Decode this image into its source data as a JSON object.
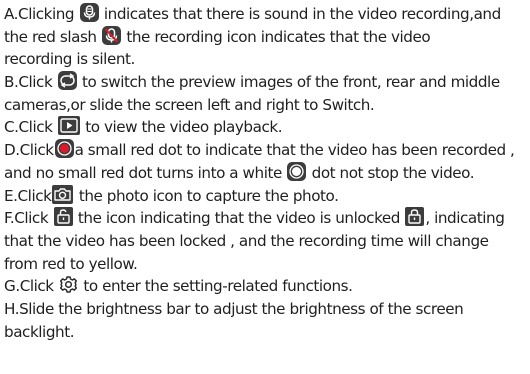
{
  "items": {
    "a": {
      "l1_pre": "A.Clicking ",
      "l1_post": " indicates that there is sound in the video recording,and",
      "l2_pre": "the red slash ",
      "l2_post": " the recording icon indicates that the video",
      "l3": "recording is silent.",
      "icon_sound": "microphone-icon",
      "icon_mute": "microphone-muted-icon"
    },
    "b": {
      "l1_pre": "B.Click ",
      "l1_post": " to switch the preview images of the front, rear and middle",
      "l2": "cameras,or slide the screen left and right to Switch.",
      "icon": "switch-camera-icon"
    },
    "c": {
      "l1_pre": "C.Click ",
      "l1_post": " to view the video playback.",
      "icon": "playback-icon"
    },
    "d": {
      "l1_pre": "D.Click",
      "l1_post": "a small red dot to indicate that the video has been recorded ,",
      "l2_pre": "and no small red dot turns into a white ",
      "l2_post": " dot not stop the video.",
      "icon_recording": "record-red-dot-icon",
      "icon_stopped": "record-white-dot-icon"
    },
    "e": {
      "l1_pre": "E.Click",
      "l1_post": " the photo icon to capture the photo.",
      "icon": "camera-icon"
    },
    "f": {
      "l1_pre": "F.Click ",
      "l1_mid": " the icon indicating that the video is unlocked ",
      "l1_post": ", indicating",
      "l2": "that the video has been locked , and the recording time will change",
      "l3": "from red to yellow.",
      "icon_unlocked": "unlock-icon",
      "icon_locked": "lock-icon"
    },
    "g": {
      "l1_pre": "G.Click ",
      "l1_post": " to enter the setting-related functions.",
      "icon": "gear-icon"
    },
    "h": {
      "l1": "H.Slide the brightness bar to adjust the brightness of the screen",
      "l2": "backlight."
    }
  },
  "colors": {
    "text": "#1f1f1f",
    "icon_bg": "#3c3c3c",
    "record_red": "#e0192a",
    "mute_slash": "#e0192a"
  }
}
